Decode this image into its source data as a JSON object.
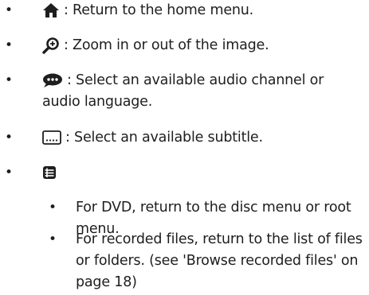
{
  "items": [
    {
      "icon": "home-icon",
      "text": ": Return to the home menu."
    },
    {
      "icon": "zoom-icon",
      "text": ": Zoom in or out of the image."
    },
    {
      "icon": "audio-speech-bubble-icon",
      "text": ": Select an available audio channel or audio language."
    },
    {
      "icon": "subtitle-icon",
      "text": ": Select an available subtitle."
    },
    {
      "icon": "disc-menu-icon",
      "text": ""
    }
  ],
  "sub_items": [
    {
      "text": "For DVD, return to the disc menu or root menu."
    },
    {
      "text": "For recorded files, return to the list of files or folders. (see 'Browse recorded files' on page 18)"
    }
  ],
  "bullet_char": "•"
}
